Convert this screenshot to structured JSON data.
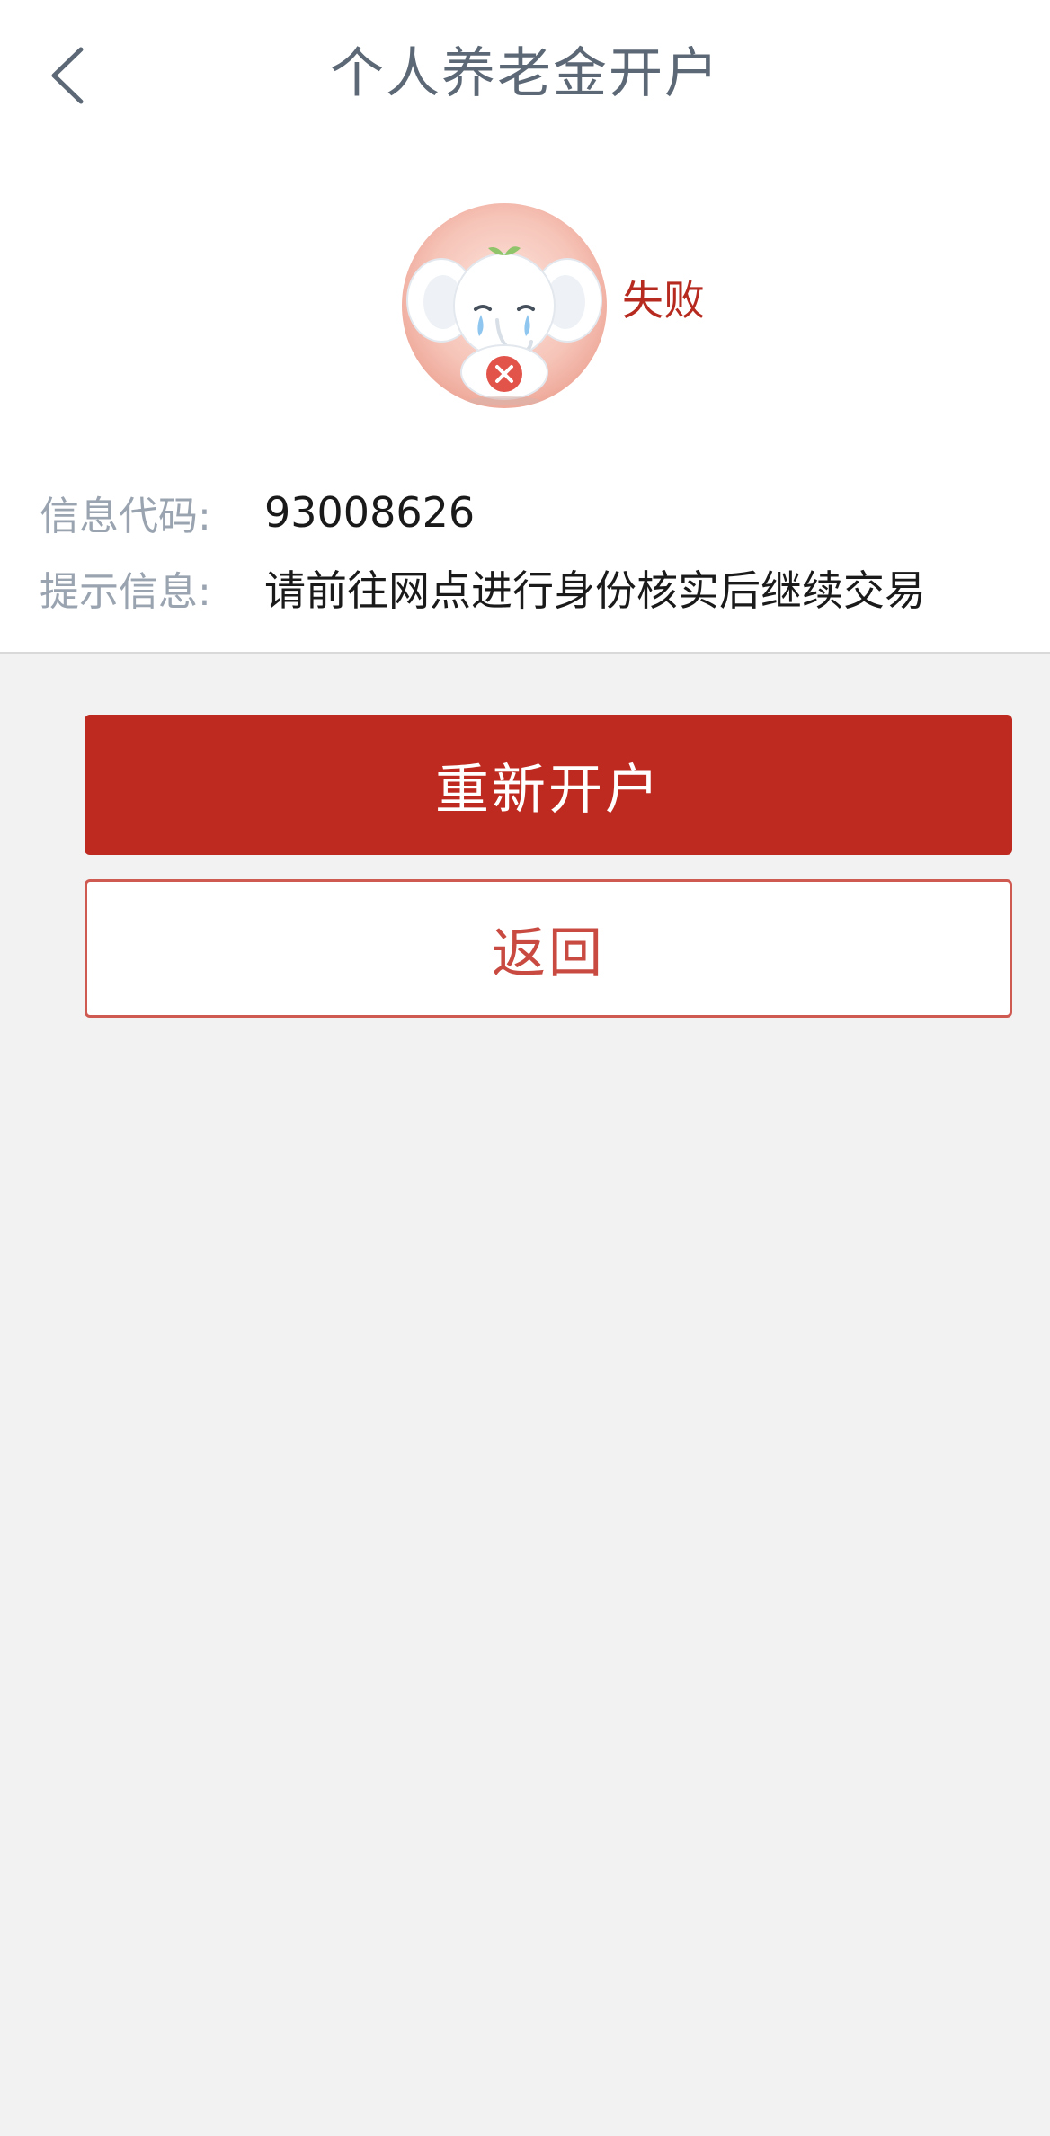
{
  "header": {
    "title": "个人养老金开户",
    "back_icon": "chevron-left-icon"
  },
  "result": {
    "status_text": "失败",
    "illustration": "crying-elephant-failure-icon",
    "status_color": "#b72a1f"
  },
  "info": {
    "code_label": "信息代码:",
    "code_value": "93008626",
    "hint_label": "提示信息:",
    "hint_value": "请前往网点进行身份核实后继续交易"
  },
  "actions": {
    "reopen_label": "重新开户",
    "back_label": "返回"
  },
  "colors": {
    "primary": "#be2a1f",
    "title_text": "#5c6876",
    "label_text": "#9aa4b0",
    "background": "#f2f2f2"
  }
}
